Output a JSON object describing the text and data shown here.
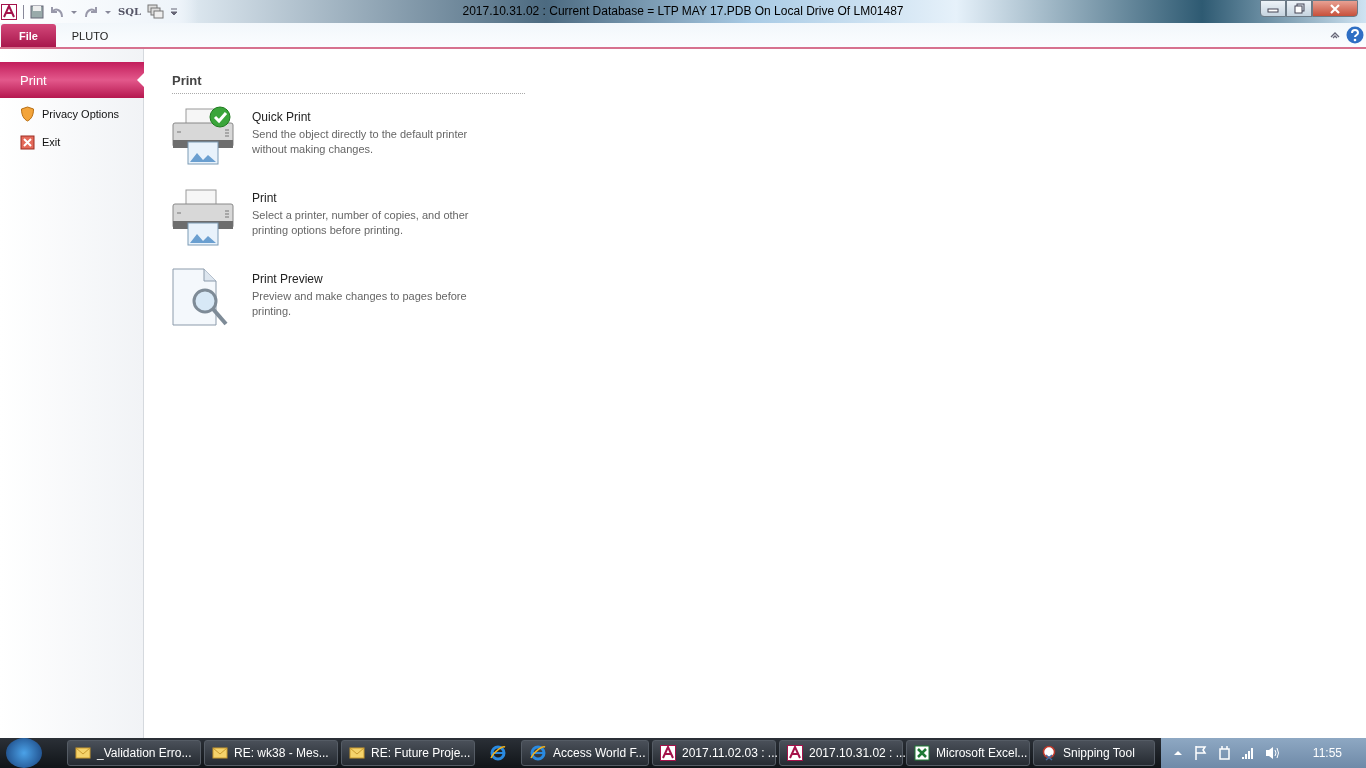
{
  "window": {
    "title": "2017.10.31.02 :  Current Database = LTP MAY 17.PDB On Local Drive Of LM01487"
  },
  "quick_access": {
    "sql_label": "SQL"
  },
  "ribbon_tabs": [
    {
      "label": "File",
      "kind": "file"
    },
    {
      "label": "PLUTO",
      "kind": "tab"
    }
  ],
  "backstage_nav": [
    {
      "label": "Print",
      "kind": "plain",
      "selected": true
    },
    {
      "label": "Privacy Options",
      "kind": "shield",
      "selected": false
    },
    {
      "label": "Exit",
      "kind": "exit",
      "selected": false
    }
  ],
  "print_panel": {
    "heading": "Print",
    "options": [
      {
        "kind": "quick-print",
        "title": "Quick Print",
        "description": "Send the object directly to the default printer without making changes."
      },
      {
        "kind": "print",
        "title": "Print",
        "description": "Select a printer, number of copies, and other printing options before printing."
      },
      {
        "kind": "preview",
        "title": "Print Preview",
        "description": "Preview and make changes to pages before printing."
      }
    ]
  },
  "taskbar": {
    "buttons": [
      {
        "kind": "mail",
        "label": "_Validation Erro..."
      },
      {
        "kind": "mail",
        "label": "RE: wk38 - Mes..."
      },
      {
        "kind": "mail",
        "label": "RE: Future Proje..."
      },
      {
        "kind": "browser-pinned"
      },
      {
        "kind": "browser",
        "label": "Access World F..."
      },
      {
        "kind": "access",
        "label": "2017.11.02.03 : ..."
      },
      {
        "kind": "access",
        "label": "2017.10.31.02 : ..."
      },
      {
        "kind": "excel",
        "label": "Microsoft Excel..."
      },
      {
        "kind": "snip",
        "label": "Snipping Tool"
      }
    ],
    "clock": "11:55"
  }
}
